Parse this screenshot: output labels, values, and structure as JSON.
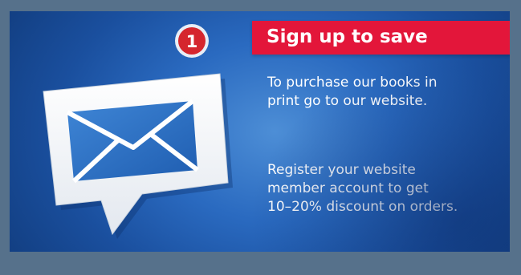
{
  "banner": {
    "headline": "Sign up to save",
    "paragraph1": [
      "To purchase our books in",
      "print go to our website."
    ],
    "paragraph2": [
      "Register your website",
      "member account to get",
      "10–20% discount on orders."
    ]
  },
  "notification": {
    "count": "1"
  },
  "icons": {
    "illustration": "envelope-speech-bubble-icon",
    "badge": "notification-badge"
  },
  "colors": {
    "headline_bar": "#e3163a",
    "background": "#1e5bb0",
    "badge": "#d5262e",
    "text": "#ffffff"
  }
}
